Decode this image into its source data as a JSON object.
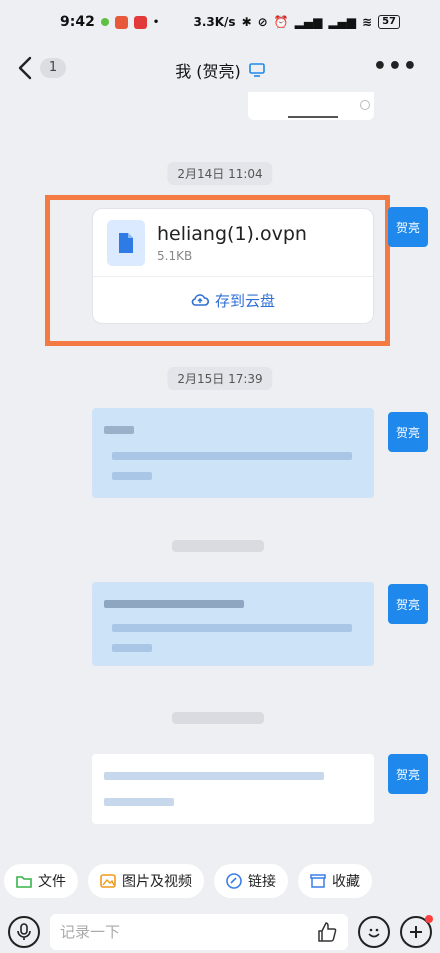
{
  "status": {
    "time": "9:42",
    "speed": "3.3K/s",
    "battery": "57"
  },
  "nav": {
    "badge_count": "1",
    "title": "我 (贺亮)"
  },
  "messages": {
    "date1": "2月14日 11:04",
    "file": {
      "name": "heliang(1).ovpn",
      "size": "5.1KB",
      "save_label": "存到云盘"
    },
    "sender": "贺亮",
    "date2": "2月15日 17:39"
  },
  "quick": {
    "file": "文件",
    "media": "图片及视频",
    "link": "链接",
    "fav": "收藏"
  },
  "input": {
    "placeholder": "记录一下"
  },
  "colors": {
    "accent": "#1f88ec",
    "highlight": "#f47a43",
    "blur_blue": "#cde3f8"
  }
}
